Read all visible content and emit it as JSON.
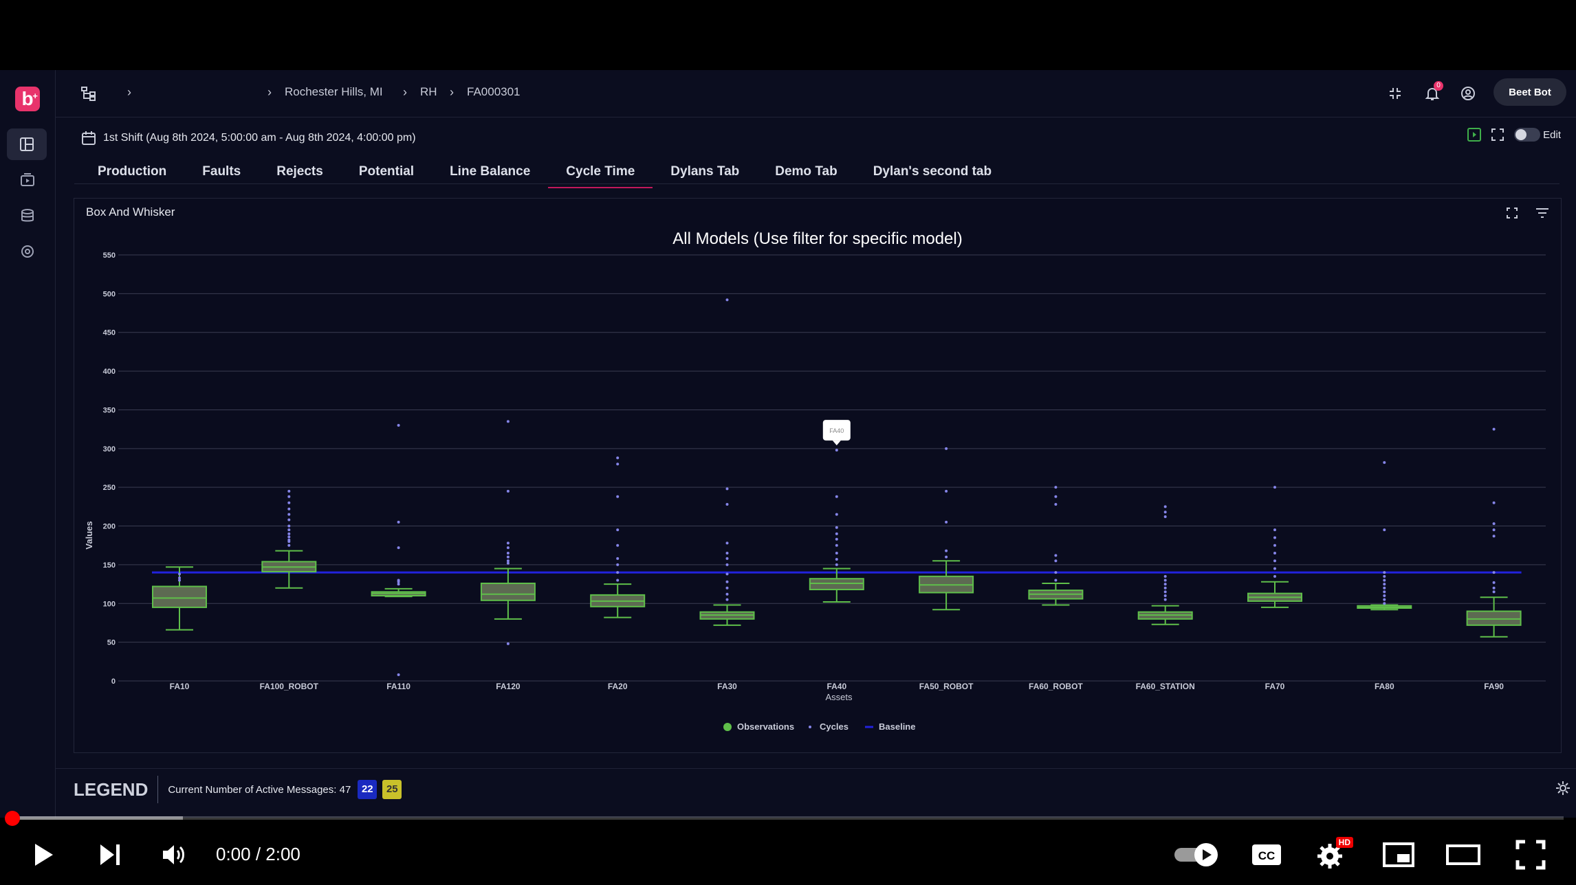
{
  "header": {
    "breadcrumbs": [
      "Rochester Hills, MI",
      "RH",
      "FA000301"
    ],
    "notification_count": "0",
    "user_name": "Beet Bot",
    "logo_text": "b"
  },
  "toolbar": {
    "shift": "1st Shift (Aug 8th 2024, 5:00:00 am - Aug 8th 2024, 4:00:00 pm)",
    "edit_label": "Edit"
  },
  "tabs": [
    {
      "label": "Production"
    },
    {
      "label": "Faults"
    },
    {
      "label": "Rejects"
    },
    {
      "label": "Potential"
    },
    {
      "label": "Line Balance"
    },
    {
      "label": "Cycle Time",
      "active": true
    },
    {
      "label": "Dylans Tab"
    },
    {
      "label": "Demo Tab"
    },
    {
      "label": "Dylan's second tab"
    }
  ],
  "panel": {
    "title": "Box And Whisker"
  },
  "chart_data": {
    "type": "box",
    "title": "All Models (Use filter for specific model)",
    "xlabel": "Assets",
    "ylabel": "Values",
    "ylim": [
      0,
      550
    ],
    "yticks": [
      0,
      50,
      100,
      150,
      200,
      250,
      300,
      350,
      400,
      450,
      500,
      550
    ],
    "grid": true,
    "legend_position": "bottom",
    "tooltip": {
      "label": "FA40",
      "category": "FA40"
    },
    "baseline": 140,
    "colors": {
      "box_fill": "#5d6a52",
      "box_edge": "#5fbf4a",
      "cycles": "#8585e8",
      "baseline": "#2222dd"
    },
    "legend": [
      {
        "label": "Observations",
        "color": "#5fbf4a"
      },
      {
        "label": "Cycles",
        "color": "#8585e8"
      },
      {
        "label": "Baseline",
        "color": "#2222dd"
      }
    ],
    "categories": [
      "FA10",
      "FA100_ROBOT",
      "FA110",
      "FA120",
      "FA20",
      "FA30",
      "FA40",
      "FA50_ROBOT",
      "FA60_ROBOT",
      "FA60_STATION",
      "FA70",
      "FA80",
      "FA90"
    ],
    "boxes": [
      {
        "min": 66,
        "q1": 95,
        "median": 107,
        "q3": 122,
        "max": 147
      },
      {
        "min": 120,
        "q1": 141,
        "median": 147,
        "q3": 154,
        "max": 168
      },
      {
        "min": 109,
        "q1": 110,
        "median": 113,
        "q3": 115,
        "max": 119
      },
      {
        "min": 80,
        "q1": 104,
        "median": 112,
        "q3": 126,
        "max": 145
      },
      {
        "min": 82,
        "q1": 96,
        "median": 103,
        "q3": 111,
        "max": 125
      },
      {
        "min": 72,
        "q1": 80,
        "median": 85,
        "q3": 89,
        "max": 98
      },
      {
        "min": 102,
        "q1": 118,
        "median": 126,
        "q3": 132,
        "max": 145
      },
      {
        "min": 92,
        "q1": 114,
        "median": 124,
        "q3": 135,
        "max": 155
      },
      {
        "min": 98,
        "q1": 106,
        "median": 112,
        "q3": 117,
        "max": 126
      },
      {
        "min": 73,
        "q1": 80,
        "median": 85,
        "q3": 89,
        "max": 97
      },
      {
        "min": 95,
        "q1": 103,
        "median": 108,
        "q3": 113,
        "max": 128
      },
      {
        "min": 92,
        "q1": 94,
        "median": 95,
        "q3": 97,
        "max": 98
      },
      {
        "min": 57,
        "q1": 72,
        "median": 80,
        "q3": 90,
        "max": 108
      }
    ],
    "outliers": [
      [
        130,
        133,
        138
      ],
      [
        175,
        182,
        190,
        200,
        208,
        215,
        222,
        230,
        238,
        245,
        195,
        186,
        180
      ],
      [
        8,
        172,
        205,
        330,
        130,
        128,
        125
      ],
      [
        48,
        245,
        160,
        165,
        172,
        178,
        335,
        155,
        152
      ],
      [
        130,
        140,
        150,
        158,
        175,
        195,
        238,
        280,
        288
      ],
      [
        120,
        128,
        138,
        150,
        158,
        165,
        178,
        228,
        248,
        492,
        112,
        105
      ],
      [
        150,
        157,
        165,
        175,
        183,
        190,
        198,
        215,
        238,
        298
      ],
      [
        168,
        205,
        245,
        300,
        160
      ],
      [
        130,
        140,
        155,
        162,
        228,
        238,
        250
      ],
      [
        105,
        110,
        115,
        120,
        125,
        130,
        135,
        212,
        218,
        225
      ],
      [
        135,
        145,
        155,
        165,
        175,
        185,
        195,
        250
      ],
      [
        100,
        105,
        110,
        115,
        120,
        125,
        130,
        135,
        140,
        195,
        282
      ],
      [
        115,
        120,
        127,
        140,
        187,
        195,
        203,
        230,
        325
      ]
    ]
  },
  "footer": {
    "legend_title": "LEGEND",
    "active_messages": "Current Number of Active Messages: 47",
    "badge_blue": "22",
    "badge_yellow": "25"
  },
  "player": {
    "time": "0:00 / 2:00",
    "progress": 0.0,
    "buffered": 0.11,
    "hd_badge": "HD"
  }
}
